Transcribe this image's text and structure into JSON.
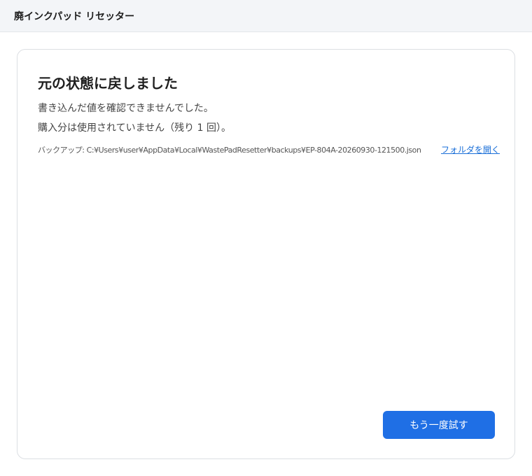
{
  "window": {
    "title": "廃インクパッド リセッター"
  },
  "result": {
    "heading": "元の状態に戻しました",
    "message_1": "書き込んだ値を確認できませんでした。",
    "message_2": "購入分は使用されていません（残り 1 回）。",
    "backup_label": "バックアップ: C:¥Users¥user¥AppData¥Local¥WastePadResetter¥backups¥EP-804A-20260930-121500.json",
    "open_folder_label": "フォルダを開く",
    "retry_label": "もう一度試す"
  },
  "colors": {
    "accent": "#1f6fe5",
    "link": "#1a6fd8",
    "titlebar_bg": "#f3f5f8"
  }
}
